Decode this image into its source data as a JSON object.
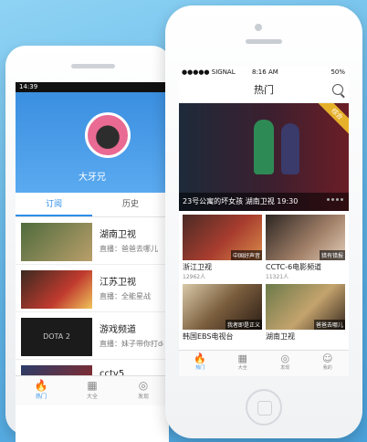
{
  "android": {
    "status_time": "14:39",
    "username": "大牙兄",
    "tabs": [
      "订阅",
      "历史"
    ],
    "list": [
      {
        "title": "湖南卫视",
        "sub": "直播：爸爸去哪儿"
      },
      {
        "title": "江苏卫视",
        "sub": "直播：全能星战"
      },
      {
        "title": "游戏频道",
        "sub": "直播：妹子带你打dota"
      },
      {
        "title": "cctv5",
        "sub": ""
      }
    ],
    "thumb_labels": {
      "dota": "DOTA 2"
    },
    "nav": [
      "热门",
      "大全",
      "发现"
    ]
  },
  "iphone": {
    "status": {
      "carrier": "●●●●● SIGNAL",
      "time": "8:16 AM",
      "battery": "50%"
    },
    "title": "热门",
    "banner": {
      "ribbon": "综合",
      "caption": "23号公寓的坏女孩  湖南卫视 19:30"
    },
    "cards": [
      {
        "title": "浙江卫视",
        "sub": "12962人",
        "tag": "中国好声音"
      },
      {
        "title": "CCTC-6电影频道",
        "sub": "11321人",
        "tag": "猎有错报"
      },
      {
        "title": "韩国EBS电视台",
        "sub": "",
        "tag": "我者即是正义"
      },
      {
        "title": "湖南卫视",
        "sub": "",
        "tag": "爸爸去哪儿"
      }
    ],
    "nav": [
      "热门",
      "大全",
      "发现",
      "我的"
    ]
  }
}
